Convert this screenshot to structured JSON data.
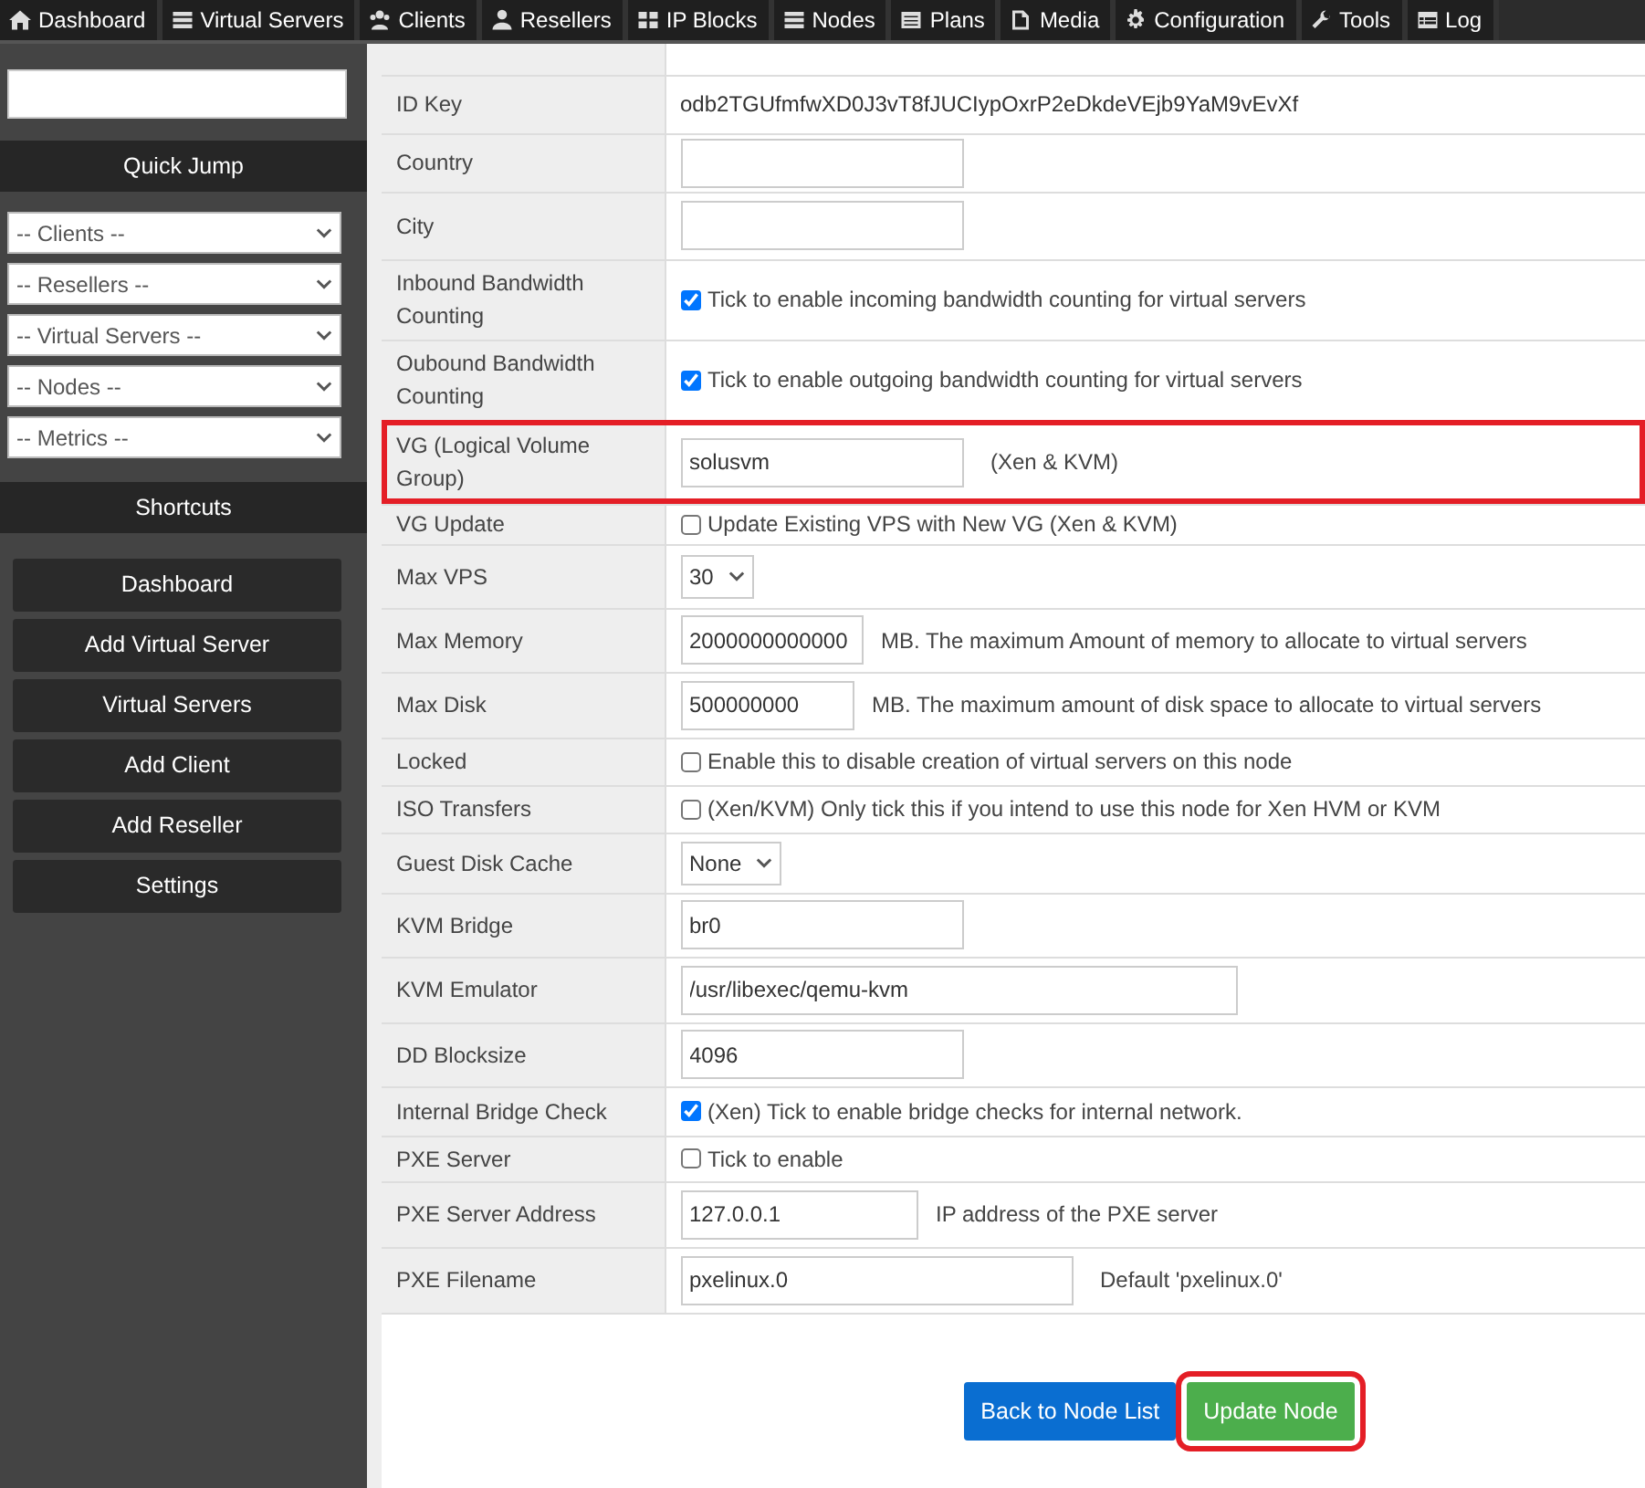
{
  "top_nav": [
    {
      "label": "Dashboard"
    },
    {
      "label": "Virtual Servers"
    },
    {
      "label": "Clients"
    },
    {
      "label": "Resellers"
    },
    {
      "label": "IP Blocks"
    },
    {
      "label": "Nodes"
    },
    {
      "label": "Plans"
    },
    {
      "label": "Media"
    },
    {
      "label": "Configuration"
    },
    {
      "label": "Tools"
    },
    {
      "label": "Log"
    }
  ],
  "sidebar": {
    "quick_jump_title": "Quick Jump",
    "selects": [
      "-- Clients --",
      "-- Resellers --",
      "-- Virtual Servers --",
      "-- Nodes --",
      "-- Metrics --"
    ],
    "shortcuts_title": "Shortcuts",
    "shortcuts": [
      "Dashboard",
      "Add Virtual Server",
      "Virtual Servers",
      "Add Client",
      "Add Reseller",
      "Settings"
    ]
  },
  "form": {
    "rows": [
      {
        "label": "ID Key",
        "kind": "text",
        "value": "odb2TGUfmfwXD0J3vT8fJUCIypOxrP2eDkdeVEjb9YaM9vEvXf"
      },
      {
        "label": "Country",
        "kind": "input",
        "value": ""
      },
      {
        "label": "City",
        "kind": "input",
        "value": ""
      },
      {
        "label": "Inbound Bandwidth Counting",
        "kind": "checkbox",
        "checked": true,
        "note": "Tick to enable incoming bandwidth counting for virtual servers"
      },
      {
        "label": "Oubound Bandwidth Counting",
        "kind": "checkbox",
        "checked": true,
        "note": "Tick to enable outgoing bandwidth counting for virtual servers"
      },
      {
        "label": "VG (Logical Volume Group)",
        "kind": "input",
        "value": "solusvm",
        "note": "(Xen & KVM)",
        "highlighted": true
      },
      {
        "label": "VG Update",
        "kind": "checkbox",
        "checked": false,
        "note": "Update Existing VPS with New VG (Xen & KVM)"
      },
      {
        "label": "Max VPS",
        "kind": "select",
        "value": "30"
      },
      {
        "label": "Max Memory",
        "kind": "input",
        "value": "2000000000000",
        "note": "MB. The maximum Amount of memory to allocate to virtual servers"
      },
      {
        "label": "Max Disk",
        "kind": "input",
        "value": "500000000",
        "note": "MB. The maximum amount of disk space to allocate to virtual servers"
      },
      {
        "label": "Locked",
        "kind": "checkbox",
        "checked": false,
        "note": "Enable this to disable creation of virtual servers on this node"
      },
      {
        "label": "ISO Transfers",
        "kind": "checkbox",
        "checked": false,
        "note": "(Xen/KVM) Only tick this if you intend to use this node for Xen HVM or KVM"
      },
      {
        "label": "Guest Disk Cache",
        "kind": "select",
        "value": "None"
      },
      {
        "label": "KVM Bridge",
        "kind": "input",
        "value": "br0"
      },
      {
        "label": "KVM Emulator",
        "kind": "input",
        "value": "/usr/libexec/qemu-kvm"
      },
      {
        "label": "DD Blocksize",
        "kind": "input",
        "value": "4096"
      },
      {
        "label": "Internal Bridge Check",
        "kind": "checkbox",
        "checked": true,
        "note": "(Xen) Tick to enable bridge checks for internal network."
      },
      {
        "label": "PXE Server",
        "kind": "checkbox",
        "checked": false,
        "note": "Tick to enable"
      },
      {
        "label": "PXE Server Address",
        "kind": "input",
        "value": "127.0.0.1",
        "note": "IP address of the PXE server"
      },
      {
        "label": "PXE Filename",
        "kind": "input",
        "value": "pxelinux.0",
        "note": "Default 'pxelinux.0'"
      }
    ]
  },
  "buttons": [
    {
      "label": "Back to Node List",
      "kind": "primary"
    },
    {
      "label": "Update Node",
      "kind": "success",
      "highlighted": true
    }
  ]
}
